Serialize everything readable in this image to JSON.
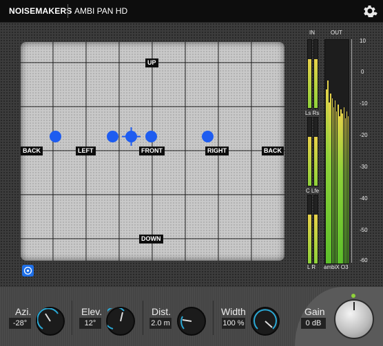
{
  "header": {
    "brand": "NOISEMAKERS",
    "product": "AMBI PAN HD",
    "settings_icon": "gear-icon"
  },
  "pad": {
    "labels": {
      "up": "UP",
      "down": "DOWN",
      "back_left": "BACK",
      "left": "LEFT",
      "front": "FRONT",
      "right": "RIGHT",
      "back_right": "BACK"
    },
    "sources": [
      {
        "name": "source-1"
      },
      {
        "name": "source-2"
      },
      {
        "name": "source-3-selected"
      },
      {
        "name": "source-4"
      },
      {
        "name": "source-5"
      }
    ],
    "source_color": "#1e5cf0",
    "toggle_icon": "target-icon"
  },
  "meters": {
    "in_label": "IN",
    "out_label": "OUT",
    "pair_labels": [
      "Ls Rs",
      "C Lfe",
      "L R"
    ],
    "out_format": "ambiX O3",
    "scale": [
      "10",
      "0",
      "-10",
      "-20",
      "-30",
      "-40",
      "-50",
      "-60"
    ]
  },
  "controls": {
    "azi": {
      "label": "Azi.",
      "value": "-28°"
    },
    "elev": {
      "label": "Elev.",
      "value": "12°"
    },
    "dist": {
      "label": "Dist.",
      "value": "2.0 m"
    },
    "width": {
      "label": "Width",
      "value": "100 %"
    },
    "gain": {
      "label": "Gain",
      "value": "0 dB"
    }
  },
  "accent": "#2aa9d6"
}
